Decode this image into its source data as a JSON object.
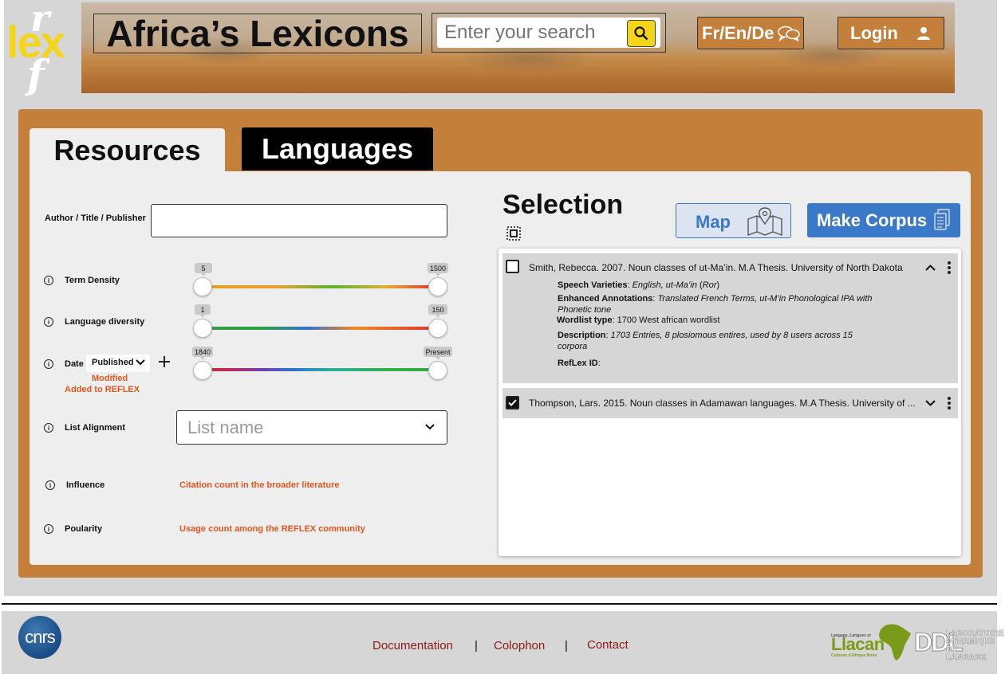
{
  "header": {
    "logo_text": "lex",
    "logo_r": "r",
    "logo_f": "f",
    "title": "Africa’s Lexicons",
    "search_placeholder": "Enter your search",
    "language_switch": "Fr/En/De",
    "login_label": "Login"
  },
  "tabs": [
    {
      "label": "Resources",
      "active": true
    },
    {
      "label": "Languages",
      "active": false
    }
  ],
  "filters": {
    "author_label": "Author / Title / Publisher",
    "author_value": "",
    "term_density": {
      "label": "Term Density",
      "min": "5",
      "max": "1500"
    },
    "language_diversity": {
      "label": "Language diversity",
      "min": "1",
      "max": "150"
    },
    "date": {
      "label": "Date",
      "selected": "Published",
      "options": [
        "Modified",
        "Added to REFLEX"
      ],
      "min": "1840",
      "max": "Present"
    },
    "list_alignment": {
      "label": "List Alignment",
      "placeholder": "List name"
    },
    "influence": {
      "label": "Influence",
      "note": "Citation count in the broader literature"
    },
    "popularity": {
      "label": "Poularity",
      "note": "Usage count among the REFLEX community"
    }
  },
  "selection": {
    "title": "Selection",
    "map_label": "Map",
    "corpus_label": "Make Corpus",
    "items": [
      {
        "title": "Smith, Rebecca. 2007. Noun classes of ut-Ma’in. M.A Thesis. University of North Dakota",
        "checked": false,
        "expanded": true,
        "speech_label": "Speech Varieties",
        "speech_value": "English, ut-Ma’in",
        "speech_code": "Ror",
        "annot_label": "Enhanced Annotations",
        "annot_value": "Translated French Terms, ut-M’in Phonological IPA with Phonetic tone",
        "wordlist_label": "Wordlist type",
        "wordlist_value": "1700 West african wordlist",
        "desc_label": "Description",
        "desc_value": "1703 Entries, 8 plosiomous entires, used by 8 users across 15 corpora",
        "reflex_label": "RefLex ID",
        "reflex_value": ""
      },
      {
        "title": "Thompson, Lars. 2015. Noun classes in Adamawan languages. M.A Thesis. University of ...",
        "checked": true,
        "expanded": false
      }
    ]
  },
  "footer": {
    "cnrs": "cnrs",
    "links": [
      "Documentation",
      "Colophon",
      "Contact"
    ],
    "separator": "|",
    "llacan": "Llacan",
    "llacan_top": "Langage, Langues et",
    "llacan_bottom": "Cultures d'Afrique Noire",
    "ddl": "DDL",
    "ddl_small": "LABORATOIRE DYNAMIQUE DU LANGAGE"
  },
  "colors": {
    "accent_orange": "#c47f3a",
    "accent_yellow": "#f5d41c",
    "accent_blue": "#3a78c8",
    "note_orange": "#e2561e",
    "link_red": "#8a1a14"
  }
}
